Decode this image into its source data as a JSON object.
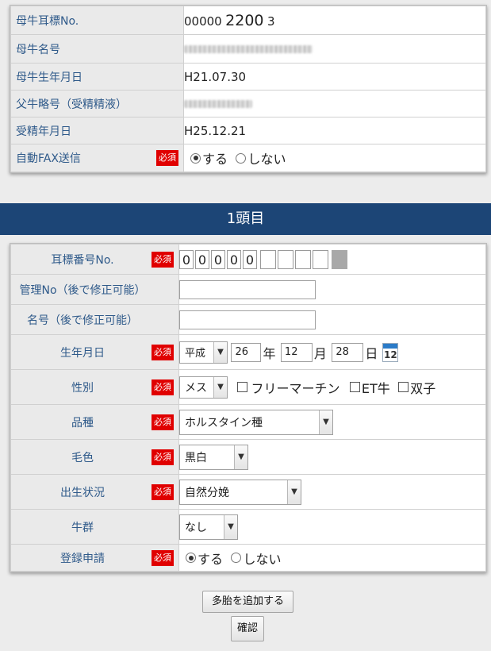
{
  "mother": {
    "ear_tag": {
      "label": "母牛耳標No.",
      "prefix": "00000",
      "main": "2200",
      "suffix": "3"
    },
    "name": {
      "label": "母牛名号"
    },
    "birth": {
      "label": "母牛生年月日",
      "value": "H21.07.30"
    },
    "father": {
      "label": "父牛略号（受精精液）"
    },
    "insemination": {
      "label": "受精年月日",
      "value": "H25.12.21"
    },
    "fax": {
      "label": "自動FAX送信",
      "required": "必須",
      "opt_yes": "する",
      "opt_no": "しない",
      "selected": "する"
    }
  },
  "section_title": "1頭目",
  "calf": {
    "ear_tag": {
      "label": "耳標番号No.",
      "required": "必須",
      "digits": [
        "0",
        "0",
        "0",
        "0",
        "0",
        "",
        "",
        "",
        "",
        ""
      ]
    },
    "mgmt_no": {
      "label": "管理No（後で修正可能）",
      "value": ""
    },
    "name": {
      "label": "名号（後で修正可能）",
      "value": ""
    },
    "birth_date": {
      "label": "生年月日",
      "required": "必須",
      "era": "平成",
      "year": "26",
      "year_unit": "年",
      "month": "12",
      "month_unit": "月",
      "day": "28",
      "day_unit": "日",
      "calendar_day": "12"
    },
    "sex": {
      "label": "性別",
      "required": "必須",
      "value": "メス",
      "free_martin": "フリーマーチン",
      "et": "ET牛",
      "twin": "双子"
    },
    "breed": {
      "label": "品種",
      "required": "必須",
      "value": "ホルスタイン種"
    },
    "color": {
      "label": "毛色",
      "required": "必須",
      "value": "黒白"
    },
    "birth_status": {
      "label": "出生状況",
      "required": "必須",
      "value": "自然分娩"
    },
    "herd": {
      "label": "牛群",
      "value": "なし"
    },
    "registration": {
      "label": "登録申請",
      "required": "必須",
      "opt_yes": "する",
      "opt_no": "しない",
      "selected": "する"
    }
  },
  "buttons": {
    "add_multi": "多胎を追加する",
    "confirm": "確認"
  }
}
